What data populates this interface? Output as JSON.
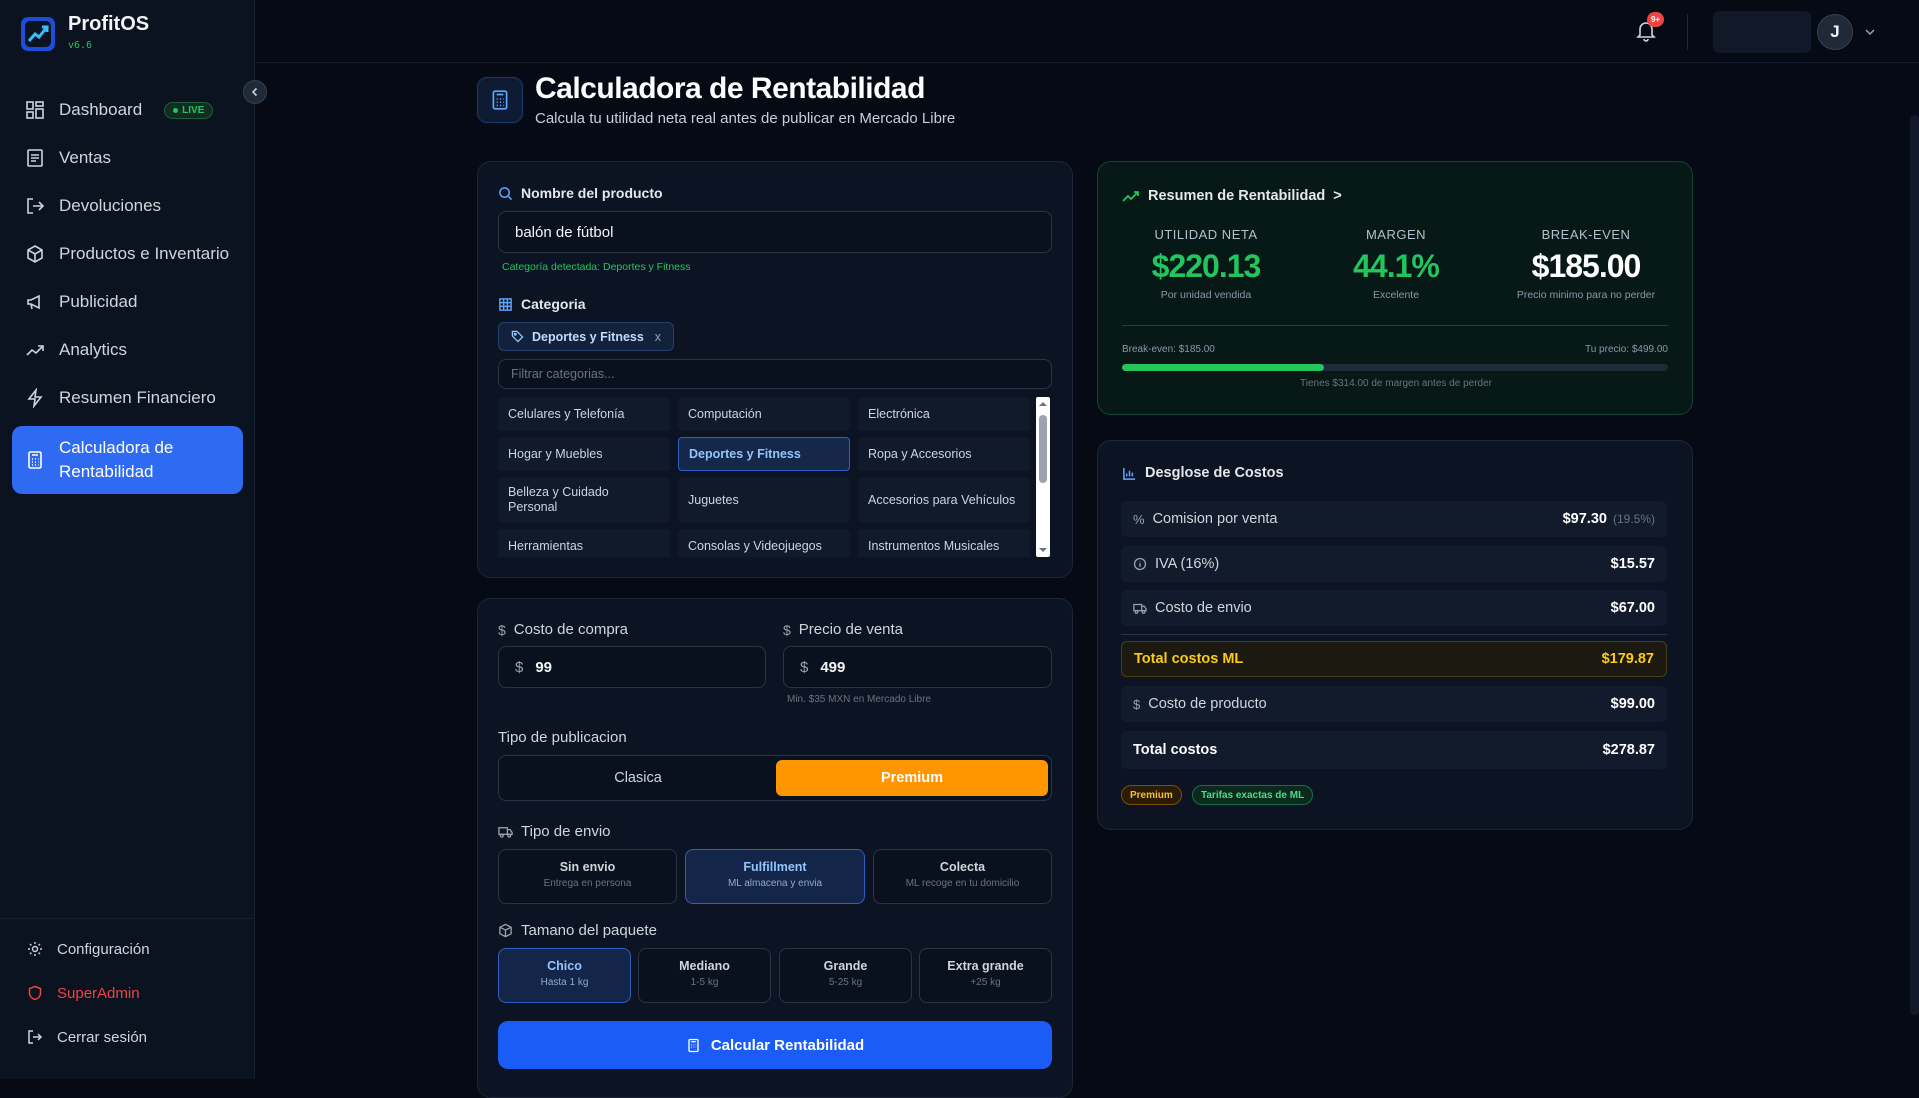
{
  "sidebar": {
    "brand": {
      "name": "ProfitOS",
      "version": "v6.6"
    },
    "live_badge": "LIVE",
    "items": [
      {
        "label": "Dashboard",
        "icon": "dashboard-icon"
      },
      {
        "label": "Ventas",
        "icon": "document-icon"
      },
      {
        "label": "Devoluciones",
        "icon": "return-icon"
      },
      {
        "label": "Productos e Inventario",
        "icon": "package-icon"
      },
      {
        "label": "Publicidad",
        "icon": "megaphone-icon"
      },
      {
        "label": "Analytics",
        "icon": "trend-icon"
      },
      {
        "label": "Resumen Financiero",
        "icon": "bolt-icon"
      },
      {
        "label": "Calculadora de Rentabilidad",
        "icon": "calculator-icon"
      }
    ],
    "bottom": [
      {
        "label": "Configuración",
        "icon": "gear-icon"
      },
      {
        "label": "SuperAdmin",
        "icon": "shield-icon"
      },
      {
        "label": "Cerrar sesión",
        "icon": "logout-icon"
      }
    ]
  },
  "topbar": {
    "notifications_badge": "9+",
    "user_initial": "J"
  },
  "header": {
    "title": "Calculadora de Rentabilidad",
    "subtitle": "Calcula tu utilidad neta real antes de publicar en Mercado Libre"
  },
  "product": {
    "label": "Nombre del producto",
    "value": "balón de fútbol",
    "detected": "Categoría detectada: Deportes y Fitness"
  },
  "category": {
    "label": "Categoria",
    "selected_chip": "Deportes y Fitness",
    "chip_remove": "x",
    "filter_placeholder": "Filtrar categorias...",
    "options": [
      "Celulares y Telefonía",
      "Computación",
      "Electrónica",
      "Hogar y Muebles",
      "Deportes y Fitness",
      "Ropa y Accesorios",
      "Belleza y Cuidado Personal",
      "Juguetes",
      "Accesorios para Vehículos",
      "Herramientas",
      "Consolas y Videojuegos",
      "Instrumentos Musicales"
    ],
    "selected_index": 4
  },
  "pricing": {
    "cost_label": "Costo de compra",
    "cost_prefix": "$",
    "cost_value": "99",
    "price_label": "Precio de venta",
    "price_prefix": "$",
    "price_value": "499",
    "price_hint": "Min. $35 MXN en Mercado Libre"
  },
  "publication": {
    "label": "Tipo de publicacion",
    "options": [
      "Clasica",
      "Premium"
    ],
    "selected": "Premium"
  },
  "shipping": {
    "label": "Tipo de envio",
    "options": [
      {
        "title": "Sin envio",
        "sub": "Entrega en persona"
      },
      {
        "title": "Fulfillment",
        "sub": "ML almacena y envia"
      },
      {
        "title": "Colecta",
        "sub": "ML recoge en tu domicilio"
      }
    ],
    "selected_index": 1
  },
  "package": {
    "label": "Tamano del paquete",
    "options": [
      {
        "title": "Chico",
        "sub": "Hasta 1 kg"
      },
      {
        "title": "Mediano",
        "sub": "1-5 kg"
      },
      {
        "title": "Grande",
        "sub": "5-25 kg"
      },
      {
        "title": "Extra grande",
        "sub": "+25 kg"
      }
    ],
    "selected_index": 0
  },
  "calculate_button": "Calcular Rentabilidad",
  "summary": {
    "title": "Resumen de Rentabilidad",
    "metrics": [
      {
        "key": "UTILIDAD NETA",
        "value": "$220.13",
        "desc": "Por unidad vendida",
        "color": "#22c55e"
      },
      {
        "key": "MARGEN",
        "value": "44.1%",
        "desc": "Excelente",
        "color": "#22c55e"
      },
      {
        "key": "BREAK-EVEN",
        "value": "$185.00",
        "desc": "Precio minimo para no perder",
        "color": "#ffffff"
      }
    ],
    "breakeven_label": "Break-even: $185.00",
    "price_label": "Tu precio: $499.00",
    "progress_fraction": 0.37,
    "margin_note": "Tienes $314.00 de margen antes de perder"
  },
  "costs": {
    "title": "Desglose de Costos",
    "rows": [
      {
        "label": "Comision por venta",
        "amount": "$97.30",
        "pct": "(19.5%)"
      },
      {
        "label": "IVA (16%)",
        "amount": "$15.57"
      },
      {
        "label": "Costo de envio",
        "amount": "$67.00"
      }
    ],
    "total_ml_label": "Total costos ML",
    "total_ml_amount": "$179.87",
    "product_cost_label": "Costo de producto",
    "product_cost_amount": "$99.00",
    "total_label": "Total costos",
    "total_amount": "$278.87",
    "badges": [
      "Premium",
      "Tarifas exactas de ML"
    ]
  },
  "colors": {
    "accent": "#1a5cf5",
    "success": "#22c55e",
    "premium": "#ff9500",
    "total_ml": "#facc15"
  }
}
